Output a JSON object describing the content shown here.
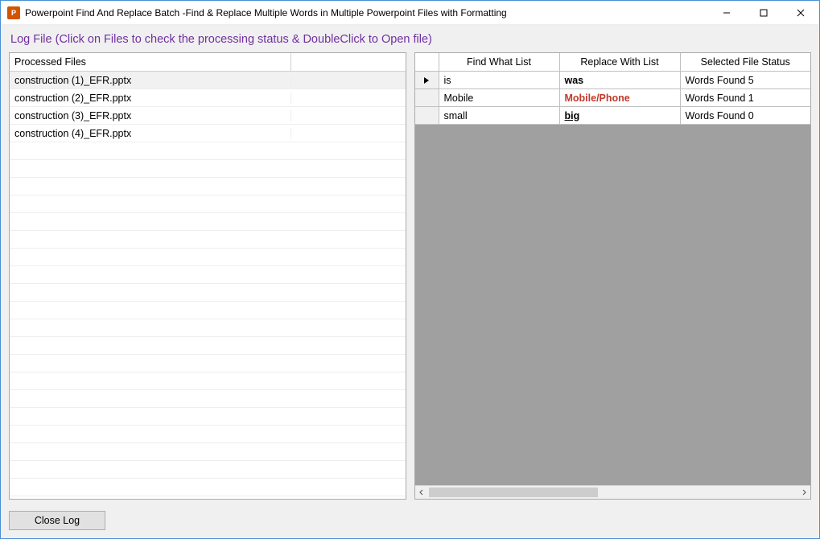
{
  "window": {
    "title": "Powerpoint Find And Replace Batch -Find & Replace Multiple Words in Multiple Powerpoint Files with Formatting",
    "app_icon_letter": "P"
  },
  "heading": "Log File (Click on Files to check the processing status & DoubleClick to Open file)",
  "left": {
    "header": "Processed Files",
    "files": [
      "construction (1)_EFR.pptx",
      "construction (2)_EFR.pptx",
      "construction (3)_EFR.pptx",
      "construction (4)_EFR.pptx"
    ],
    "selected_index": 0
  },
  "right": {
    "columns": {
      "find": "Find What List",
      "replace": "Replace With List",
      "status": "Selected File Status"
    },
    "rows": [
      {
        "find": "is",
        "replace": "was",
        "replace_style": "bold",
        "status": "Words Found 5",
        "current": true
      },
      {
        "find": "Mobile",
        "replace": "Mobile/Phone",
        "replace_style": "bold red",
        "status": "Words Found 1",
        "current": false
      },
      {
        "find": "small",
        "replace": "big",
        "replace_style": "bold underline",
        "status": "Words Found 0",
        "current": false
      }
    ]
  },
  "footer": {
    "close_label": "Close Log"
  }
}
